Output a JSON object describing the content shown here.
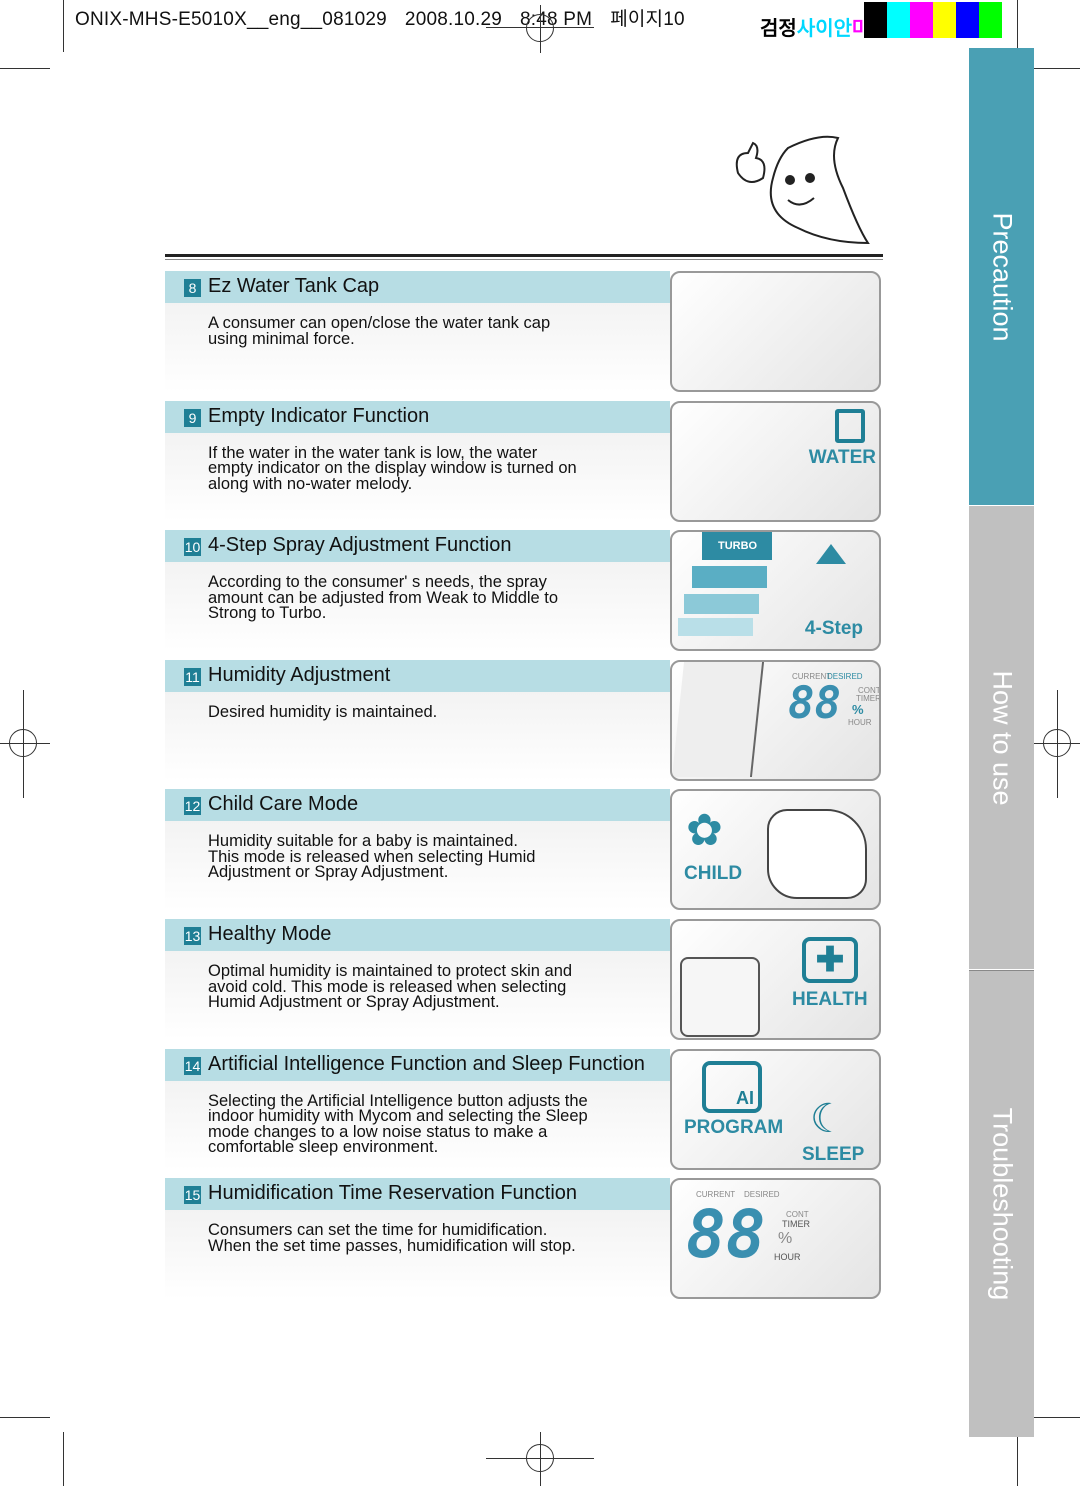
{
  "header": {
    "file": "ONIX-MHS-E5010X__eng__081029",
    "date": "2008.10.29",
    "time": "8:48 PM",
    "page": "페이지10",
    "color_text": "검정사이안마젠타노랑",
    "color_bars": [
      "#000000",
      "#00ffff",
      "#ff00ff",
      "#ffff00",
      "#0000ff",
      "#00ff00"
    ]
  },
  "colors": {
    "accent": "#4aa0b4",
    "band": "#b7dde4",
    "number_badge": "#1f7f95",
    "tab_inactive": "#c0c0c0"
  },
  "side_tabs": [
    {
      "label": "Precaution",
      "active": true
    },
    {
      "label": "How to use",
      "active": false
    },
    {
      "label": "Troubleshooting",
      "active": false
    }
  ],
  "sections": [
    {
      "num": "8",
      "title": "Ez Water Tank Cap",
      "lines": [
        "A consumer can open/close the water tank cap",
        "using minimal force."
      ],
      "image": {
        "icon": "water-tank-cap-illustration",
        "labels": []
      }
    },
    {
      "num": "9",
      "title": "Empty Indicator Function",
      "lines": [
        "If the water in the water tank is low, the water",
        "empty indicator on the display window is turned on",
        "along with no-water melody."
      ],
      "image": {
        "icon": "water-empty-illustration",
        "labels": [
          "WATER"
        ]
      }
    },
    {
      "num": "10",
      "title": "4-Step Spray Adjustment Function",
      "lines": [
        "According to the consumer' s needs, the spray",
        "amount can be adjusted from Weak to Middle to",
        "Strong to Turbo."
      ],
      "image": {
        "icon": "spray-step-illustration",
        "labels": [
          "TURBO",
          "4-Step"
        ]
      }
    },
    {
      "num": "11",
      "title": "Humidity Adjustment",
      "lines": [
        "Desired humidity is maintained."
      ],
      "image": {
        "icon": "humidity-display-illustration",
        "labels": [
          "CURRENT",
          "DESIRED",
          "88",
          "%",
          "CONT",
          "TIMER",
          "HOUR"
        ]
      }
    },
    {
      "num": "12",
      "title": "Child Care Mode",
      "lines": [
        "Humidity suitable for a baby is maintained.",
        "This mode is released when selecting Humid",
        "Adjustment or Spray Adjustment."
      ],
      "image": {
        "icon": "child-mode-illustration",
        "labels": [
          "CHILD"
        ]
      }
    },
    {
      "num": "13",
      "title": "Healthy Mode",
      "lines": [
        "Optimal humidity is maintained to protect skin and",
        "avoid cold. This mode is released when selecting",
        "Humid Adjustment or Spray Adjustment."
      ],
      "image": {
        "icon": "health-mode-illustration",
        "labels": [
          "HEALTH"
        ]
      }
    },
    {
      "num": "14",
      "title": "Artificial Intelligence Function and Sleep Function",
      "lines": [
        "Selecting the Artificial Intelligence button adjusts the",
        "indoor humidity with Mycom and selecting the Sleep",
        "mode changes to a low noise status to make a",
        "comfortable sleep environment."
      ],
      "image": {
        "icon": "program-sleep-illustration",
        "labels": [
          "AI",
          "PROGRAM",
          "SLEEP"
        ]
      }
    },
    {
      "num": "15",
      "title": "Humidification Time Reservation Function",
      "lines": [
        "Consumers can set the time for humidification.",
        "When the set time passes, humidification will stop."
      ],
      "image": {
        "icon": "timer-display-illustration",
        "labels": [
          "CURRENT",
          "DESIRED",
          "88",
          "CONT",
          "TIMER",
          "%",
          "HOUR"
        ]
      }
    }
  ]
}
